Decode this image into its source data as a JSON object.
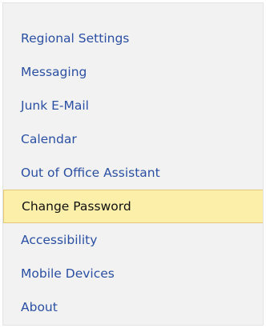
{
  "nav": {
    "items": [
      {
        "label": "Regional Settings",
        "selected": false
      },
      {
        "label": "Messaging",
        "selected": false
      },
      {
        "label": "Junk E-Mail",
        "selected": false
      },
      {
        "label": "Calendar",
        "selected": false
      },
      {
        "label": "Out of Office Assistant",
        "selected": false
      },
      {
        "label": "Change Password",
        "selected": true
      },
      {
        "label": "Accessibility",
        "selected": false
      },
      {
        "label": "Mobile Devices",
        "selected": false
      },
      {
        "label": "About",
        "selected": false
      }
    ]
  },
  "colors": {
    "link": "#2a4fa3",
    "selected_background": "#fcefa9",
    "selected_border": "#e5c774",
    "panel_background": "#f2f2f2"
  }
}
